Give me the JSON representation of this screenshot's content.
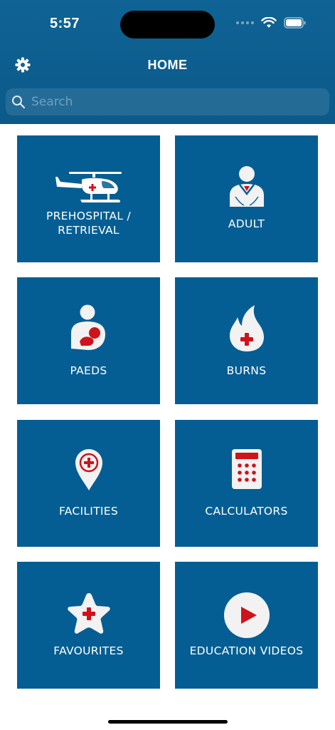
{
  "status": {
    "time": "5:57"
  },
  "nav": {
    "title": "HOME"
  },
  "search": {
    "placeholder": "Search"
  },
  "tiles": [
    {
      "label_line1": "PREHOSPITAL /",
      "label_line2": "RETRIEVAL",
      "icon": "helicopter-icon"
    },
    {
      "label": "ADULT",
      "icon": "adult-person-icon"
    },
    {
      "label": "PAEDS",
      "icon": "parent-child-icon"
    },
    {
      "label": "BURNS",
      "icon": "flame-icon"
    },
    {
      "label": "FACILITIES",
      "icon": "location-pin-icon"
    },
    {
      "label": "CALCULATORS",
      "icon": "calculator-icon"
    },
    {
      "label": "FAVOURITES",
      "icon": "star-icon"
    },
    {
      "label": "EDUCATION VIDEOS",
      "icon": "play-icon"
    }
  ],
  "colors": {
    "header": "#0f6395",
    "tile": "#045e93",
    "accent_red": "#d0121b"
  }
}
